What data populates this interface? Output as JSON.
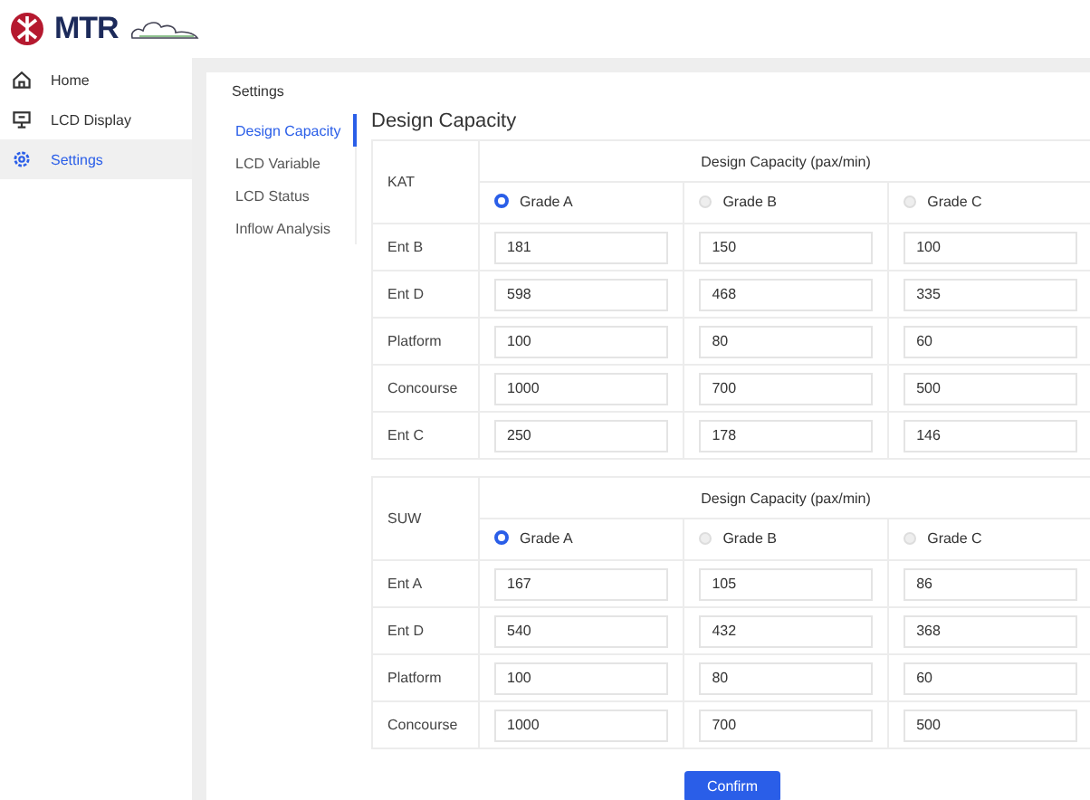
{
  "logo": {
    "text": "MTR"
  },
  "nav": [
    {
      "label": "Home",
      "kind": "home",
      "selected": false
    },
    {
      "label": "LCD Display",
      "kind": "display",
      "selected": false
    },
    {
      "label": "Settings",
      "kind": "settings",
      "selected": true
    }
  ],
  "breadcrumb": "Settings",
  "settings_menu": [
    {
      "label": "Design Capacity",
      "selected": true
    },
    {
      "label": "LCD Variable",
      "selected": false
    },
    {
      "label": "LCD Status",
      "selected": false
    },
    {
      "label": "Inflow Analysis",
      "selected": false
    }
  ],
  "section_title": "Design Capacity",
  "tables": [
    {
      "station": "KAT",
      "header": "Design Capacity (pax/min)",
      "grades": [
        {
          "label": "Grade A",
          "selected": true
        },
        {
          "label": "Grade B",
          "selected": false
        },
        {
          "label": "Grade C",
          "selected": false
        }
      ],
      "rows": [
        {
          "name": "Ent B",
          "values": [
            "181",
            "150",
            "100"
          ]
        },
        {
          "name": "Ent D",
          "values": [
            "598",
            "468",
            "335"
          ]
        },
        {
          "name": "Platform",
          "values": [
            "100",
            "80",
            "60"
          ]
        },
        {
          "name": "Concourse",
          "values": [
            "1000",
            "700",
            "500"
          ]
        },
        {
          "name": "Ent C",
          "values": [
            "250",
            "178",
            "146"
          ]
        }
      ]
    },
    {
      "station": "SUW",
      "header": "Design Capacity (pax/min)",
      "grades": [
        {
          "label": "Grade A",
          "selected": true
        },
        {
          "label": "Grade B",
          "selected": false
        },
        {
          "label": "Grade C",
          "selected": false
        }
      ],
      "rows": [
        {
          "name": "Ent A",
          "values": [
            "167",
            "105",
            "86"
          ]
        },
        {
          "name": "Ent D",
          "values": [
            "540",
            "432",
            "368"
          ]
        },
        {
          "name": "Platform",
          "values": [
            "100",
            "80",
            "60"
          ]
        },
        {
          "name": "Concourse",
          "values": [
            "1000",
            "700",
            "500"
          ]
        }
      ]
    }
  ],
  "confirm_button": "Confirm"
}
